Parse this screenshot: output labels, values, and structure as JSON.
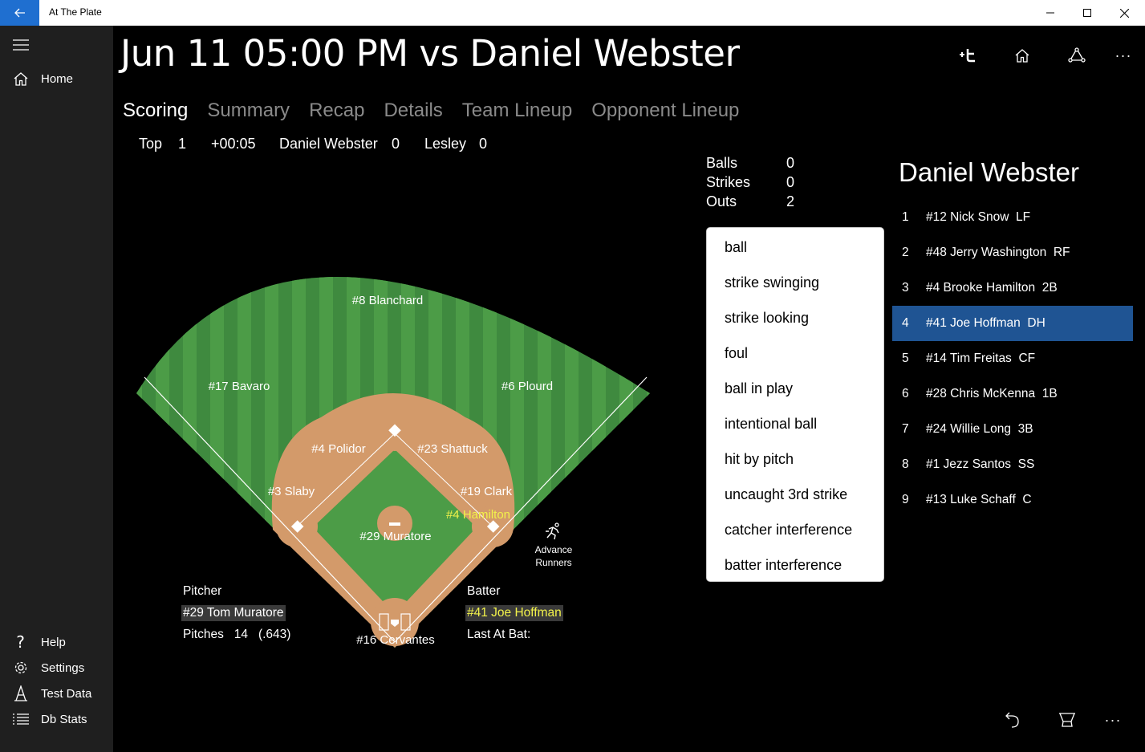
{
  "window": {
    "title": "At The Plate"
  },
  "nav": {
    "items": [
      {
        "label": "Home",
        "icon": "home-icon"
      },
      {
        "label": "Help",
        "icon": "help-icon"
      },
      {
        "label": "Settings",
        "icon": "gear-icon"
      },
      {
        "label": "Test Data",
        "icon": "test-data-icon"
      },
      {
        "label": "Db Stats",
        "icon": "list-icon"
      }
    ]
  },
  "header": {
    "title": "Jun 11 05:00 PM vs Daniel Webster"
  },
  "tabs": [
    "Scoring",
    "Summary",
    "Recap",
    "Details",
    "Team Lineup",
    "Opponent Lineup"
  ],
  "score": {
    "half": "Top",
    "inning": "1",
    "time": "+00:05",
    "away_team": "Daniel Webster",
    "away_runs": "0",
    "home_team": "Lesley",
    "home_runs": "0"
  },
  "count": {
    "balls_label": "Balls",
    "balls": "0",
    "strikes_label": "Strikes",
    "strikes": "0",
    "outs_label": "Outs",
    "outs": "2"
  },
  "pitches": [
    "ball",
    "strike swinging",
    "strike looking",
    "foul",
    "ball in play",
    "intentional ball",
    "hit by pitch",
    "uncaught 3rd strike",
    "catcher interference",
    "batter interference"
  ],
  "lineup": {
    "team": "Daniel Webster",
    "selected_index": 3,
    "rows": [
      {
        "order": "1",
        "player": "#12 Nick Snow",
        "pos": "LF"
      },
      {
        "order": "2",
        "player": "#48 Jerry Washington",
        "pos": "RF"
      },
      {
        "order": "3",
        "player": "#4 Brooke Hamilton",
        "pos": "2B"
      },
      {
        "order": "4",
        "player": "#41 Joe Hoffman",
        "pos": "DH"
      },
      {
        "order": "5",
        "player": "#14 Tim Freitas",
        "pos": "CF"
      },
      {
        "order": "6",
        "player": "#28 Chris McKenna",
        "pos": "1B"
      },
      {
        "order": "7",
        "player": "#24 Willie Long",
        "pos": "3B"
      },
      {
        "order": "8",
        "player": "#1 Jezz Santos",
        "pos": "SS"
      },
      {
        "order": "9",
        "player": "#13 Luke Schaff",
        "pos": "C"
      }
    ]
  },
  "field": {
    "cf": "#8 Blanchard",
    "lf": "#17 Bavaro",
    "rf": "#6 Plourd",
    "ss": "#4 Polidor",
    "second": "#23 Shattuck",
    "third": "#3 Slaby",
    "first": "#19 Clark",
    "runner": "#4 Hamilton",
    "pitcher": "#29 Muratore",
    "catcher": "#16 Cervantes",
    "colors": {
      "grass_dark": "#3f8a3f",
      "grass_light": "#4c9c47",
      "dirt": "#d39a6a",
      "runner": "#f2f24a"
    }
  },
  "pitcher_info": {
    "label": "Pitcher",
    "name": "#29 Tom Muratore",
    "pitches_label": "Pitches",
    "pitches": "14",
    "pct": "(.643)"
  },
  "batter_info": {
    "label": "Batter",
    "name": "#41 Joe Hoffman",
    "last_label": "Last At Bat:"
  },
  "advance": {
    "line1": "Advance",
    "line2": "Runners"
  },
  "colors": {
    "accent": "#1f6fd0",
    "selected_row": "#1f5493",
    "nav_bg": "#1f1f1f"
  }
}
